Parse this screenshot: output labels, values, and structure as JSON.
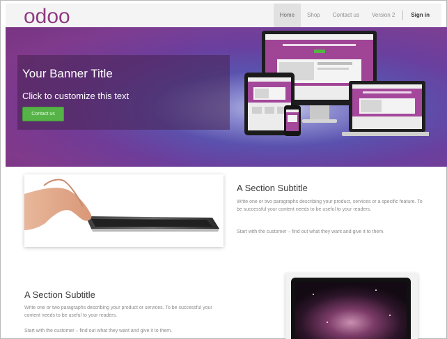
{
  "brand": {
    "logo_text": "odoo"
  },
  "nav": {
    "items": [
      {
        "label": "Home",
        "active": true
      },
      {
        "label": "Shop"
      },
      {
        "label": "Contact us"
      },
      {
        "label": "Version 2"
      }
    ],
    "sign_in": "Sign in"
  },
  "banner": {
    "title": "Your Banner Title",
    "text": "Click to customize this text",
    "button_label": "Contact us"
  },
  "section1": {
    "subtitle": "A Section Subtitle",
    "paragraph1": "Write one or two paragraphs describing your product, services or a specific feature. To be successful your content needs to be useful to your readers.",
    "paragraph2": "Start with the customer – find out what they want and give it to them."
  },
  "section2": {
    "subtitle": "A Section Subtitle",
    "paragraph1": "Write one or two paragraphs describing your product or services. To be successful your content needs to be useful to your readers.",
    "paragraph2": "Start with the customer – find out what they want and give it to them."
  },
  "colors": {
    "accent_green": "#56b348",
    "banner_purple": "#6e3887",
    "logo_purple": "#8f3b83"
  }
}
